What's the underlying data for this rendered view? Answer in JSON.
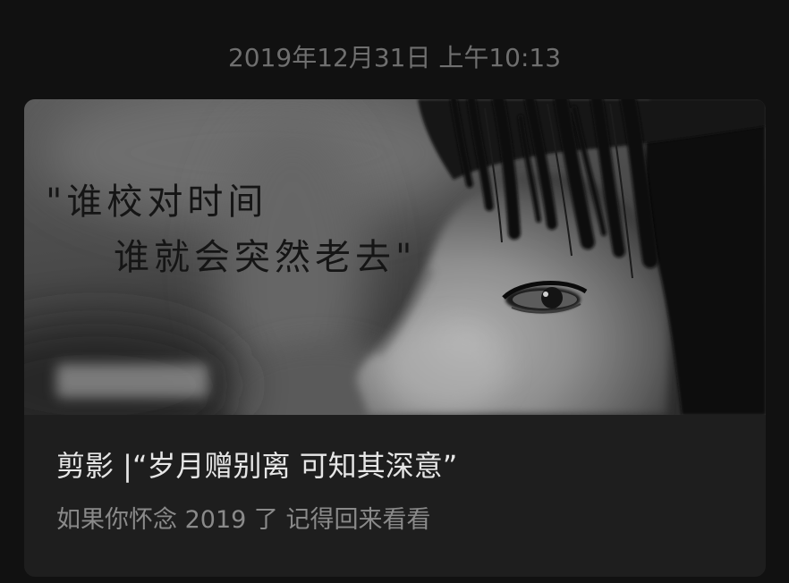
{
  "timestamp": "2019年12月31日 上午10:13",
  "article": {
    "cover": {
      "overlay_line1": "\"谁校对时间",
      "overlay_line2": "谁就会突然老去\""
    },
    "title": "剪影 |“岁月赠别离 可知其深意”",
    "digest": "如果你怀念 2019 了 记得回来看看"
  },
  "colors": {
    "background": "#111111",
    "card": "#1e1e1e",
    "title": "#e6e6e6",
    "digest": "#8a8a8a",
    "timestamp": "#6f6f6f",
    "overlay_text": "#151515"
  }
}
